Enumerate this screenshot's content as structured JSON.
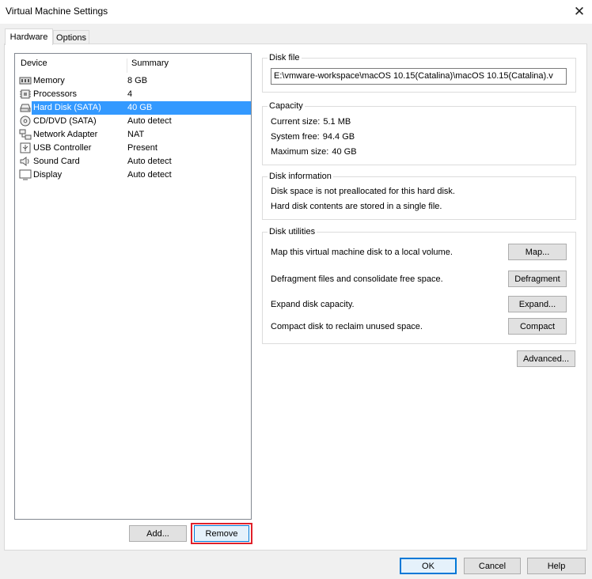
{
  "window": {
    "title": "Virtual Machine Settings"
  },
  "tabs": [
    {
      "label": "Hardware",
      "active": true
    },
    {
      "label": "Options",
      "active": false
    }
  ],
  "device_list": {
    "columns": [
      "Device",
      "Summary"
    ],
    "rows": [
      {
        "device": "Memory",
        "summary": "8 GB",
        "icon": "memory-icon"
      },
      {
        "device": "Processors",
        "summary": "4",
        "icon": "processor-icon"
      },
      {
        "device": "Hard Disk (SATA)",
        "summary": "40 GB",
        "icon": "hard-disk-icon",
        "selected": true
      },
      {
        "device": "CD/DVD (SATA)",
        "summary": "Auto detect",
        "icon": "cd-dvd-icon"
      },
      {
        "device": "Network Adapter",
        "summary": "NAT",
        "icon": "network-adapter-icon"
      },
      {
        "device": "USB Controller",
        "summary": "Present",
        "icon": "usb-icon"
      },
      {
        "device": "Sound Card",
        "summary": "Auto detect",
        "icon": "speaker-icon"
      },
      {
        "device": "Display",
        "summary": "Auto detect",
        "icon": "display-icon"
      }
    ],
    "add_label": "Add...",
    "remove_label": "Remove"
  },
  "disk_file": {
    "title": "Disk file",
    "value": "E:\\vmware-workspace\\macOS 10.15(Catalina)\\macOS 10.15(Catalina).v"
  },
  "capacity": {
    "title": "Capacity",
    "current_label": "Current size:",
    "current_value": "5.1 MB",
    "free_label": "System free:",
    "free_value": "94.4 GB",
    "max_label": "Maximum size:",
    "max_value": "40 GB"
  },
  "disk_info": {
    "title": "Disk information",
    "line1": "Disk space is not preallocated for this hard disk.",
    "line2": "Hard disk contents are stored in a single file."
  },
  "disk_utilities": {
    "title": "Disk utilities",
    "items": [
      {
        "text": "Map this virtual machine disk to a local volume.",
        "button": "Map..."
      },
      {
        "text": "Defragment files and consolidate free space.",
        "button": "Defragment"
      },
      {
        "text": "Expand disk capacity.",
        "button": "Expand..."
      },
      {
        "text": "Compact disk to reclaim unused space.",
        "button": "Compact"
      }
    ]
  },
  "advanced_label": "Advanced...",
  "footer": {
    "ok": "OK",
    "cancel": "Cancel",
    "help": "Help"
  },
  "colors": {
    "selection": "#3399ff",
    "highlight_border": "#e0202a",
    "focus": "#0078d7"
  }
}
